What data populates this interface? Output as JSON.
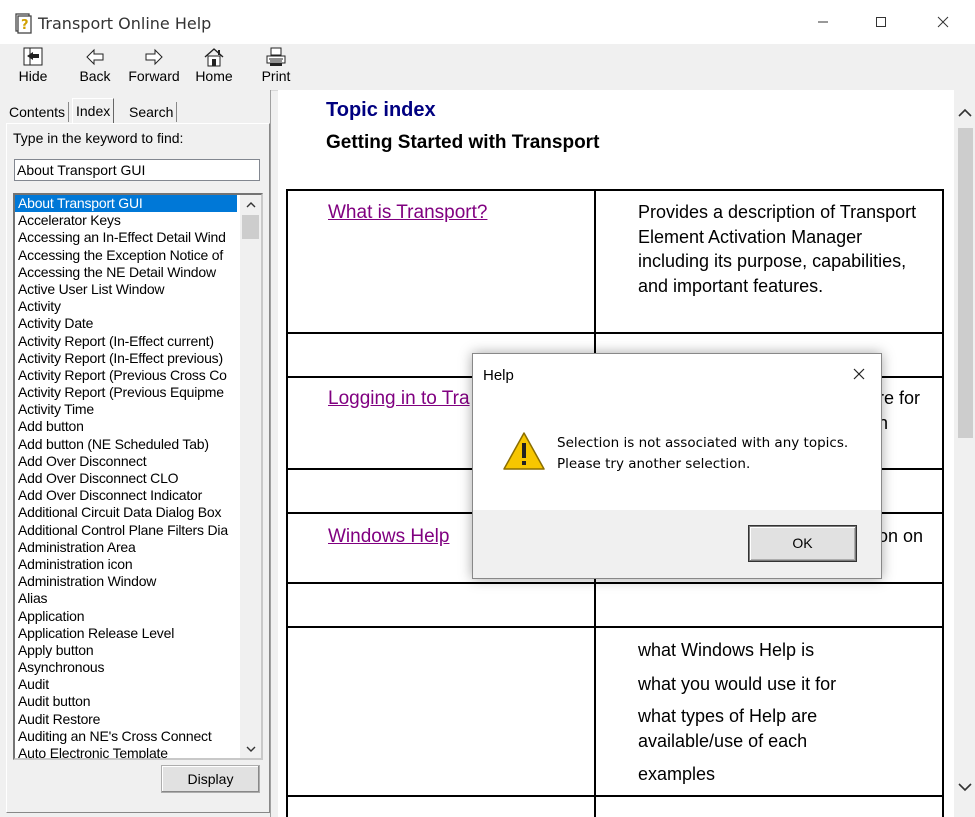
{
  "window": {
    "title": "Transport Online Help",
    "controls": {
      "minimize": "minimize",
      "maximize": "maximize",
      "close": "close"
    }
  },
  "toolbar": {
    "buttons": [
      {
        "label": "Hide",
        "icon": "hide-icon"
      },
      {
        "label": "Back",
        "icon": "back-arrow-icon"
      },
      {
        "label": "Forward",
        "icon": "forward-arrow-icon"
      },
      {
        "label": "Home",
        "icon": "home-icon"
      },
      {
        "label": "Print",
        "icon": "printer-icon"
      }
    ]
  },
  "nav": {
    "tabs": [
      "Contents",
      "Index",
      "Search"
    ],
    "active_tab": "Index",
    "keyword_label": "Type in the keyword to find:",
    "keyword_value": "About Transport GUI",
    "selected_item": "About Transport GUI",
    "items": [
      "About Transport GUI",
      "Accelerator Keys",
      "Accessing an In-Effect Detail Wind",
      "Accessing the Exception Notice of",
      "Accessing the NE Detail Window",
      "Active User List Window",
      "Activity",
      "Activity Date",
      "Activity Report (In-Effect current)",
      "Activity Report (In-Effect previous)",
      "Activity Report (Previous Cross Co",
      "Activity Report (Previous Equipme",
      "Activity Time",
      "Add button",
      "Add button (NE Scheduled Tab)",
      "Add Over Disconnect",
      "Add Over Disconnect CLO",
      "Add Over Disconnect Indicator",
      "Additional Circuit Data Dialog Box",
      "Additional Control Plane Filters Dia",
      "Administration Area",
      "Administration icon",
      "Administration Window",
      "Alias",
      "Application",
      "Application Release Level",
      "Apply button",
      "Asynchronous",
      "Audit",
      "Audit button",
      "Audit Restore",
      "Auditing an NE's Cross Connect",
      "Auto Electronic Template"
    ],
    "display_button": "Display"
  },
  "content": {
    "heading": "Topic index",
    "subheading": "Getting Started with Transport",
    "rows": [
      {
        "link": "What is Transport?",
        "description": "Provides a description of Transport Element Activation Manager including its purpose, capabilities, and important features."
      },
      {
        "link": "Logging in to Tra",
        "description": "re for\nn"
      },
      {
        "link": "Windows Help",
        "description": "on on"
      }
    ],
    "help_list": [
      "what Windows Help is",
      "what you would use it for",
      "what types of Help are available/use of each",
      "examples"
    ]
  },
  "dialog": {
    "title": "Help",
    "icon": "warning-icon",
    "message_line1": "Selection is not associated with any topics.",
    "message_line2": "Please try another selection.",
    "ok_label": "OK"
  }
}
